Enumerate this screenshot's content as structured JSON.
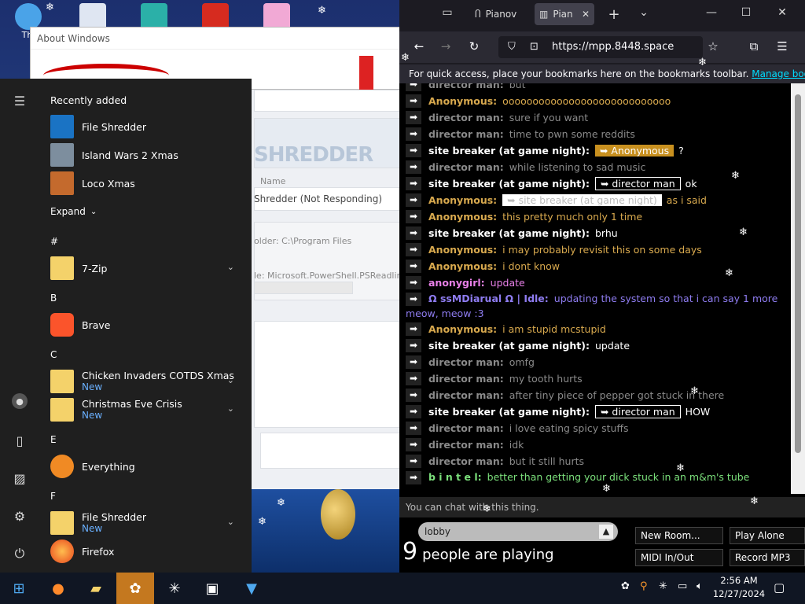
{
  "desktop": {
    "icons": [
      {
        "label": "Thi",
        "icon": "this-pc-icon"
      },
      {
        "label": "",
        "icon": "app-icon"
      },
      {
        "label": "",
        "icon": "game-icon"
      },
      {
        "label": "",
        "icon": "mcdonalds-icon"
      },
      {
        "label": "",
        "icon": "pony-icon"
      }
    ]
  },
  "about_window": {
    "title": "About Windows"
  },
  "shredder_window": {
    "logo": "SHREDDER",
    "col_name": "Name",
    "title_line": "Shredder (Not Responding)",
    "folder_line": "older: C:\\Program Files",
    "file_line": "le: Microsoft.PowerShell.PSReadline.Re"
  },
  "start_menu": {
    "recently_added_title": "Recently added",
    "recent": [
      {
        "label": "File Shredder",
        "icon": "file-shredder-icon"
      },
      {
        "label": "Island Wars 2 Xmas",
        "icon": "island-wars-icon"
      },
      {
        "label": "Loco Xmas",
        "icon": "loco-xmas-icon"
      }
    ],
    "expand_label": "Expand",
    "sections": {
      "hash": "#",
      "b": "B",
      "c": "C",
      "e": "E",
      "f": "F"
    },
    "apps": {
      "seven_zip": "7-Zip",
      "brave": "Brave",
      "chicken": "Chicken Invaders COTDS Xmas",
      "christmas": "Christmas Eve Crisis",
      "everything": "Everything",
      "file_shredder": "File Shredder",
      "firefox": "Firefox"
    },
    "new_badge": "New"
  },
  "browser": {
    "tabs": [
      {
        "label": "Pianov",
        "icon": "piano-icon"
      },
      {
        "label": "Pian",
        "icon": "piano-keys-icon"
      }
    ],
    "url": "https://mpp.8448.space",
    "bookmarks_text": "For quick access, place your bookmarks here on the bookmarks toolbar.",
    "bookmarks_link": "Manage bookmarks..."
  },
  "piano_site": {
    "messages": [
      {
        "name": "director man:",
        "text": "but",
        "color": "#8a8a8a"
      },
      {
        "name": "Anonymous:",
        "text": "oooooooooooooooooooooooooooo",
        "color": "#d8a94e"
      },
      {
        "name": "director man:",
        "text": "sure if you want",
        "color": "#8a8a8a"
      },
      {
        "name": "director man:",
        "text": "time to pwn some reddits",
        "color": "#8a8a8a"
      },
      {
        "name": "site breaker (at game night):",
        "pill": "➥ Anonymous",
        "pill_bg": "#c8901f",
        "text": "?",
        "color": "#ffffff"
      },
      {
        "name": "director man:",
        "text": "while listening to sad music",
        "color": "#8a8a8a"
      },
      {
        "name": "site breaker (at game night):",
        "pill": "➥ director man",
        "pill_bg": "#000000",
        "text": "ok",
        "color": "#ffffff"
      },
      {
        "name": "Anonymous:",
        "pill": "➥ site breaker (at game night)",
        "pill_bg": "#ffffff",
        "text": "as i said",
        "color": "#d8a94e"
      },
      {
        "name": "Anonymous:",
        "text": "this pretty much only 1 time",
        "color": "#d8a94e"
      },
      {
        "name": "site breaker (at game night):",
        "text": "brhu",
        "color": "#ffffff"
      },
      {
        "name": "Anonymous:",
        "text": "i may probably revisit this on some days",
        "color": "#d8a94e"
      },
      {
        "name": "Anonymous:",
        "text": "i dont know",
        "color": "#d8a94e"
      },
      {
        "name": "anonygirl:",
        "text": "update",
        "color": "#e880e8"
      },
      {
        "name": "Ω ssMDiarual Ω | Idle:",
        "text": "updating the system so that i can say 1 more meow, meow :3",
        "color": "#8e7cf0"
      },
      {
        "name": "Anonymous:",
        "text": "i am stupid mcstupid",
        "color": "#d8a94e"
      },
      {
        "name": "site breaker (at game night):",
        "text": "update",
        "color": "#ffffff"
      },
      {
        "name": "director man:",
        "text": "omfg",
        "color": "#8a8a8a"
      },
      {
        "name": "director man:",
        "text": "my tooth hurts",
        "color": "#8a8a8a"
      },
      {
        "name": "director man:",
        "text": "after tiny piece of pepper got stuck in there",
        "color": "#8a8a8a"
      },
      {
        "name": "site breaker (at game night):",
        "pill": "➥ director man",
        "pill_bg": "#000000",
        "text": "HOW",
        "color": "#ffffff"
      },
      {
        "name": "director man:",
        "text": "i love eating spicy stuffs",
        "color": "#8a8a8a"
      },
      {
        "name": "director man:",
        "text": "idk",
        "color": "#8a8a8a"
      },
      {
        "name": "director man:",
        "text": "but it still hurts",
        "color": "#8a8a8a"
      },
      {
        "name": "b i n t e l:",
        "text": "better than getting your dick stuck in an m&m's tube",
        "color": "#7be07b"
      }
    ],
    "chat_placeholder": "You can chat with this thing.",
    "room": "lobby",
    "player_count": "9",
    "players_label": "people are playing",
    "buttons": {
      "new_room": "New Room...",
      "play_alone": "Play Alone",
      "midi": "MIDI In/Out",
      "record": "Record MP3"
    }
  },
  "taskbar": {
    "time": "2:56 AM",
    "date": "12/27/2024"
  }
}
